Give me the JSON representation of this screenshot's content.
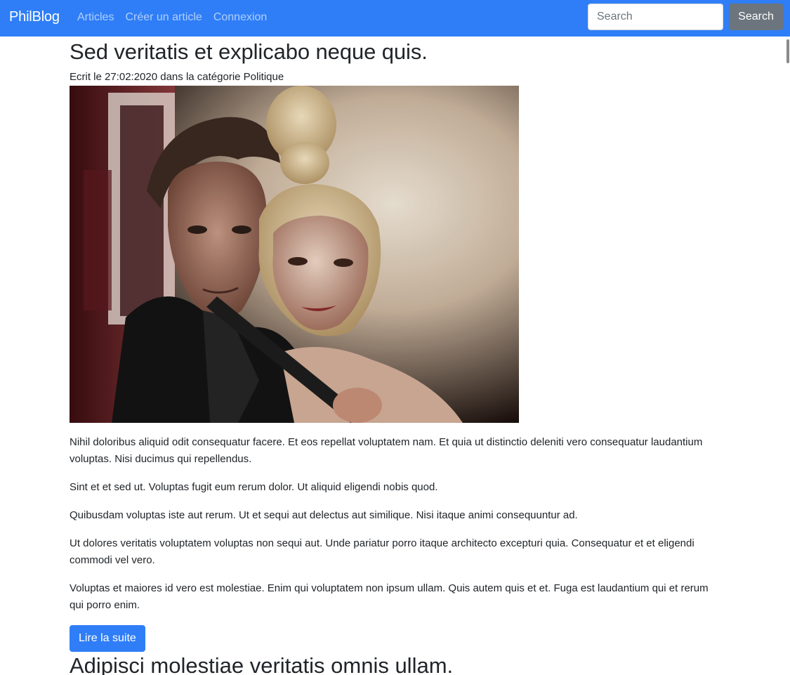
{
  "navbar": {
    "brand": "PhilBlog",
    "links": [
      "Articles",
      "Créer un article",
      "Connexion"
    ],
    "search_placeholder": "Search",
    "search_button": "Search"
  },
  "article": {
    "title": "Sed veritatis et explicabo neque quis.",
    "meta": "Ecrit le 27:02:2020 dans la catégorie Politique",
    "paragraphs": [
      "Nihil doloribus aliquid odit consequatur facere. Et eos repellat voluptatem nam. Et quia ut distinctio deleniti vero consequatur laudantium voluptas. Nisi ducimus qui repellendus.",
      "Sint et et sed ut. Voluptas fugit eum rerum dolor. Ut aliquid eligendi nobis quod.",
      "Quibusdam voluptas iste aut rerum. Ut et sequi aut delectus aut similique. Nisi itaque animi consequuntur ad.",
      "Ut dolores veritatis voluptatem voluptas non sequi aut. Unde pariatur porro itaque architecto excepturi quia. Consequatur et et eligendi commodi vel vero.",
      "Voluptas et maiores id vero est molestiae. Enim qui voluptatem non ipsum ullam. Quis autem quis et et. Fuga est laudantium qui et rerum qui porro enim."
    ],
    "read_more": "Lire la suite"
  },
  "next_article": {
    "title": "Adipisci molestiae veritatis omnis ullam."
  },
  "colors": {
    "navbar_bg": "#2f7ef7",
    "primary_button": "#2f7ef7",
    "secondary_button": "#6c757d"
  }
}
